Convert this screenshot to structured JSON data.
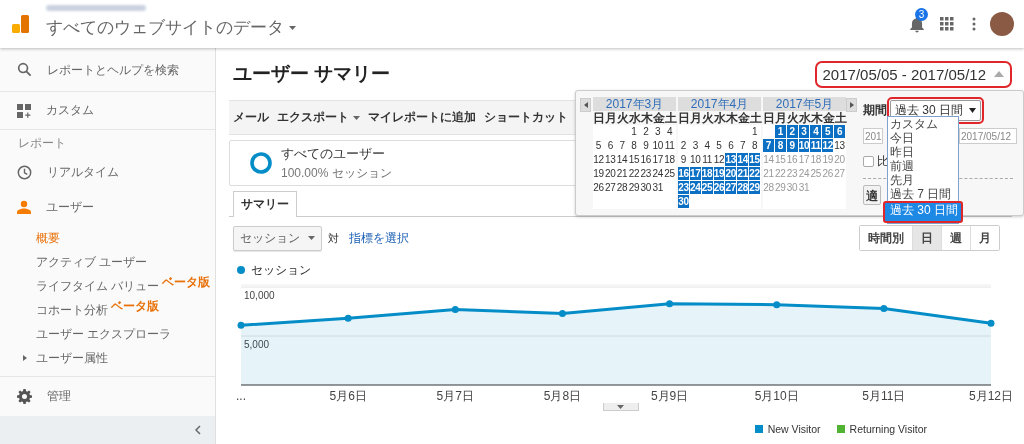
{
  "header": {
    "title": "すべてのウェブサイトのデータ",
    "notification_count": "3"
  },
  "sidebar": {
    "search": {
      "placeholder": "レポートとヘルプを検索"
    },
    "custom": "カスタム",
    "section_label": "レポート",
    "realtime": "リアルタイム",
    "users": {
      "label": "ユーザー",
      "active": true,
      "children": [
        {
          "label": "概要",
          "selected": true
        },
        {
          "label": "アクティブ ユーザー",
          "selected": false
        },
        {
          "label": "ライフタイム バリュー",
          "badge": "ベータ版",
          "selected": false
        },
        {
          "label": "コホート分析",
          "badge": "ベータ版",
          "selected": false
        },
        {
          "label": "ユーザー エクスプローラ",
          "selected": false
        },
        {
          "label": "ユーザー属性",
          "selected": false,
          "expanded": false
        }
      ]
    },
    "admin": "管理"
  },
  "report": {
    "title": "ユーザー サマリー",
    "date_range": {
      "text": "2017/05/05 - 2017/05/12",
      "highlighted": true,
      "open": true
    },
    "toolbar": [
      {
        "label": "メール",
        "menu": false
      },
      {
        "label": "エクスポート",
        "menu": true
      },
      {
        "label": "マイレポートに追加",
        "menu": false
      },
      {
        "label": "ショートカット",
        "menu": false
      }
    ],
    "segment": {
      "name": "すべてのユーザー",
      "share": "100.00% セッション"
    },
    "tabs": [
      {
        "label": "サマリー",
        "selected": true
      }
    ],
    "metric": {
      "selected": "セッション",
      "versus": "対",
      "add_metric": "指標を選択"
    },
    "granularity": [
      {
        "label": "時間別",
        "selected": false
      },
      {
        "label": "日",
        "selected": true
      },
      {
        "label": "週",
        "selected": false
      },
      {
        "label": "月",
        "selected": false
      }
    ],
    "chart": {
      "chart_data": {
        "type": "area",
        "x": [
          "...",
          "5月6日",
          "5月7日",
          "5月8日",
          "5月9日",
          "5月10日",
          "5月11日",
          "5月12日"
        ],
        "series": [
          {
            "name": "セッション",
            "color": "#058dc7",
            "values": [
              6100,
              6800,
              7700,
              7300,
              8300,
              8200,
              7800,
              6300
            ]
          }
        ],
        "ylim": [
          0,
          10000
        ],
        "yticks": [
          {
            "value": 5000,
            "label": "5,000"
          },
          {
            "value": 10000,
            "label": "10,000"
          }
        ]
      }
    },
    "visitor_legend": [
      {
        "label": "New Visitor",
        "color": "#058dc7"
      },
      {
        "label": "Returning Visitor",
        "color": "#50b432"
      }
    ]
  },
  "date_picker": {
    "months": [
      {
        "title": "2017年3月",
        "weekdays": [
          "日",
          "月",
          "火",
          "水",
          "木",
          "金",
          "土"
        ],
        "weeks": [
          [
            {
              "day": "1",
              "selected": false,
              "disabled": false
            },
            {
              "day": "2",
              "selected": false,
              "disabled": false
            },
            {
              "day": "3",
              "selected": false,
              "disabled": false
            },
            {
              "day": "4",
              "selected": false,
              "disabled": false
            }
          ],
          [
            {
              "day": "5",
              "selected": false,
              "disabled": false
            },
            {
              "day": "6",
              "selected": false,
              "disabled": false
            },
            {
              "day": "7",
              "selected": false,
              "disabled": false
            },
            {
              "day": "8",
              "selected": false,
              "disabled": false
            },
            {
              "day": "9",
              "selected": false,
              "disabled": false
            },
            {
              "day": "10",
              "selected": false,
              "disabled": false
            },
            {
              "day": "11",
              "selected": false,
              "disabled": false
            }
          ],
          [
            {
              "day": "12",
              "selected": false,
              "disabled": false
            },
            {
              "day": "13",
              "selected": false,
              "disabled": false
            },
            {
              "day": "14",
              "selected": false,
              "disabled": false
            },
            {
              "day": "15",
              "selected": false,
              "disabled": false
            },
            {
              "day": "16",
              "selected": false,
              "disabled": false
            },
            {
              "day": "17",
              "selected": false,
              "disabled": false
            },
            {
              "day": "18",
              "selected": false,
              "disabled": false
            }
          ],
          [
            {
              "day": "19",
              "selected": false,
              "disabled": false
            },
            {
              "day": "20",
              "selected": false,
              "disabled": false
            },
            {
              "day": "21",
              "selected": false,
              "disabled": false
            },
            {
              "day": "22",
              "selected": false,
              "disabled": false
            },
            {
              "day": "23",
              "selected": false,
              "disabled": false
            },
            {
              "day": "24",
              "selected": false,
              "disabled": false
            },
            {
              "day": "25",
              "selected": false,
              "disabled": false
            }
          ],
          [
            {
              "day": "26",
              "selected": false,
              "disabled": false
            },
            {
              "day": "27",
              "selected": false,
              "disabled": false
            },
            {
              "day": "28",
              "selected": false,
              "disabled": false
            },
            {
              "day": "29",
              "selected": false,
              "disabled": false
            },
            {
              "day": "30",
              "selected": false,
              "disabled": false
            },
            {
              "day": "31",
              "selected": false,
              "disabled": false
            }
          ]
        ]
      },
      {
        "title": "2017年4月",
        "weekdays": [
          "日",
          "月",
          "火",
          "水",
          "木",
          "金",
          "土"
        ],
        "weeks": [
          [
            {
              "day": "1",
              "selected": false,
              "disabled": false
            }
          ],
          [
            {
              "day": "2",
              "selected": false,
              "disabled": false
            },
            {
              "day": "3",
              "selected": false,
              "disabled": false
            },
            {
              "day": "4",
              "selected": false,
              "disabled": false
            },
            {
              "day": "5",
              "selected": false,
              "disabled": false
            },
            {
              "day": "6",
              "selected": false,
              "disabled": false
            },
            {
              "day": "7",
              "selected": false,
              "disabled": false
            },
            {
              "day": "8",
              "selected": false,
              "disabled": false
            }
          ],
          [
            {
              "day": "9",
              "selected": false,
              "disabled": false
            },
            {
              "day": "10",
              "selected": false,
              "disabled": false
            },
            {
              "day": "11",
              "selected": false,
              "disabled": false
            },
            {
              "day": "12",
              "selected": false,
              "disabled": false
            },
            {
              "day": "13",
              "selected": true,
              "disabled": false
            },
            {
              "day": "14",
              "selected": true,
              "disabled": false
            },
            {
              "day": "15",
              "selected": true,
              "disabled": false
            }
          ],
          [
            {
              "day": "16",
              "selected": true,
              "disabled": false
            },
            {
              "day": "17",
              "selected": true,
              "disabled": false
            },
            {
              "day": "18",
              "selected": true,
              "disabled": false
            },
            {
              "day": "19",
              "selected": true,
              "disabled": false
            },
            {
              "day": "20",
              "selected": true,
              "disabled": false
            },
            {
              "day": "21",
              "selected": true,
              "disabled": false
            },
            {
              "day": "22",
              "selected": true,
              "disabled": false
            }
          ],
          [
            {
              "day": "23",
              "selected": true,
              "disabled": false
            },
            {
              "day": "24",
              "selected": true,
              "disabled": false
            },
            {
              "day": "25",
              "selected": true,
              "disabled": false
            },
            {
              "day": "26",
              "selected": true,
              "disabled": false
            },
            {
              "day": "27",
              "selected": true,
              "disabled": false
            },
            {
              "day": "28",
              "selected": true,
              "disabled": false
            },
            {
              "day": "29",
              "selected": true,
              "disabled": false
            }
          ],
          [
            {
              "day": "30",
              "selected": true,
              "disabled": false
            }
          ]
        ]
      },
      {
        "title": "2017年5月",
        "weekdays": [
          "日",
          "月",
          "火",
          "水",
          "木",
          "金",
          "土"
        ],
        "weeks": [
          [
            {
              "day": "1",
              "selected": true,
              "disabled": false
            },
            {
              "day": "2",
              "selected": true,
              "disabled": false
            },
            {
              "day": "3",
              "selected": true,
              "disabled": false
            },
            {
              "day": "4",
              "selected": true,
              "disabled": false
            },
            {
              "day": "5",
              "selected": true,
              "disabled": false
            },
            {
              "day": "6",
              "selected": true,
              "disabled": false
            }
          ],
          [
            {
              "day": "7",
              "selected": true,
              "disabled": false
            },
            {
              "day": "8",
              "selected": true,
              "disabled": false
            },
            {
              "day": "9",
              "selected": true,
              "disabled": false
            },
            {
              "day": "10",
              "selected": true,
              "disabled": false
            },
            {
              "day": "11",
              "selected": true,
              "disabled": false
            },
            {
              "day": "12",
              "selected": true,
              "disabled": false
            },
            {
              "day": "13",
              "selected": false,
              "disabled": false
            }
          ],
          [
            {
              "day": "14",
              "selected": false,
              "disabled": true
            },
            {
              "day": "15",
              "selected": false,
              "disabled": true
            },
            {
              "day": "16",
              "selected": false,
              "disabled": true
            },
            {
              "day": "17",
              "selected": false,
              "disabled": true
            },
            {
              "day": "18",
              "selected": false,
              "disabled": true
            },
            {
              "day": "19",
              "selected": false,
              "disabled": true
            },
            {
              "day": "20",
              "selected": false,
              "disabled": true
            }
          ],
          [
            {
              "day": "21",
              "selected": false,
              "disabled": true
            },
            {
              "day": "22",
              "selected": false,
              "disabled": true
            },
            {
              "day": "23",
              "selected": false,
              "disabled": true
            },
            {
              "day": "24",
              "selected": false,
              "disabled": true
            },
            {
              "day": "25",
              "selected": false,
              "disabled": true
            },
            {
              "day": "26",
              "selected": false,
              "disabled": true
            },
            {
              "day": "27",
              "selected": false,
              "disabled": true
            }
          ],
          [
            {
              "day": "28",
              "selected": false,
              "disabled": true
            },
            {
              "day": "29",
              "selected": false,
              "disabled": true
            },
            {
              "day": "30",
              "selected": false,
              "disabled": true
            },
            {
              "day": "31",
              "selected": false,
              "disabled": true
            }
          ]
        ]
      }
    ],
    "period_label": "期間",
    "period_select": {
      "value": "過去 30 日間",
      "highlighted": true,
      "open": true,
      "options": [
        {
          "label": "カスタム",
          "selected": false,
          "highlighted": false
        },
        {
          "label": "今日",
          "selected": false,
          "highlighted": false
        },
        {
          "label": "昨日",
          "selected": false,
          "highlighted": false
        },
        {
          "label": "前週",
          "selected": false,
          "highlighted": false
        },
        {
          "label": "先月",
          "selected": false,
          "highlighted": false
        },
        {
          "label": "過去 7 日間",
          "selected": false,
          "highlighted": false
        },
        {
          "label": "過去 30 日間",
          "selected": true,
          "highlighted": true
        }
      ]
    },
    "start_date": "201",
    "end_date": "2017/05/12",
    "compare": {
      "label": "比",
      "checked": false
    },
    "apply": "適"
  }
}
